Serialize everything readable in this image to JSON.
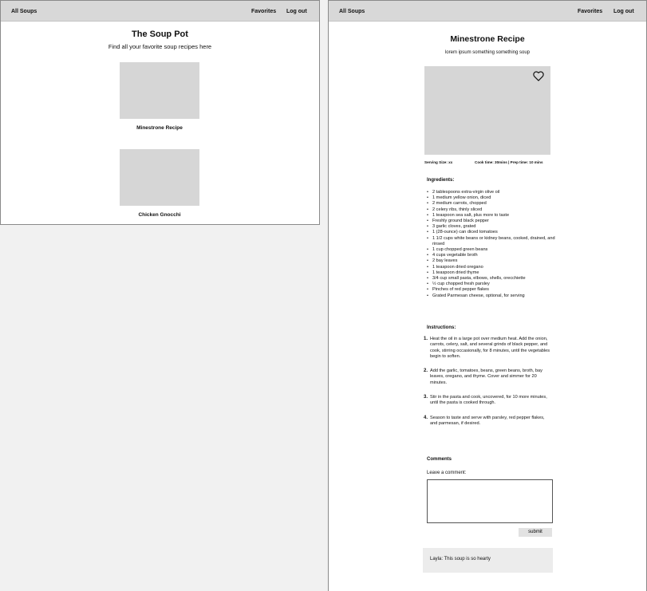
{
  "home": {
    "nav": {
      "all_soups": "All Soups",
      "favorites": "Favorites",
      "logout": "Log out"
    },
    "title": "The Soup Pot",
    "subtitle": "Find all your favorite soup recipes here",
    "recipes": [
      {
        "label": "Minestrone Recipe"
      },
      {
        "label": "Chicken Gnocchi"
      }
    ]
  },
  "recipe": {
    "nav": {
      "all_soups": "All Soups",
      "favorites": "Favorites",
      "logout": "Log out"
    },
    "title": "Minestrone Recipe",
    "subtitle": "lorem ipsum something something soup",
    "heart_icon": "heart-outline-icon",
    "serving_size": "Serving Size: xx",
    "times": "Cook time: 30mins | Prep time: 10 mins",
    "ingredients_title": "Ingredients:",
    "ingredients": [
      "2 tablespoons extra-virgin olive oil",
      "1 medium yellow onion, diced",
      "2 medium carrots, chopped",
      "2 celery ribs, thinly sliced",
      "1 teaspoon sea salt, plus more to taste",
      "Freshly ground black pepper",
      "3 garlic cloves, grated",
      "1 (28-ounce) can diced tomatoes",
      "1 1/2 cups white beans or kidney beans, cooked, drained, and rinsed",
      "1 cup chopped green beans",
      "4 cups vegetable broth",
      "2 bay leaves",
      "1 teaspoon dried oregano",
      "1 teaspoon dried thyme",
      "3/4 cup small pasta, elbows, shells, orecchiette",
      "½ cup chopped fresh parsley",
      "Pinches of red pepper flakes",
      "Grated Parmesan cheese, optional, for serving"
    ],
    "instructions_title": "Instructions:",
    "instructions": [
      {
        "num": "1.",
        "text": "Heat the oil in a large pot over medium heat. Add the onion, carrots, celery, salt, and several grinds of black pepper, and cook, stirring occasionally, for 8 minutes, until the vegetables begin to soften."
      },
      {
        "num": "2.",
        "text": "Add the garlic, tomatoes, beans, green beans, broth, bay leaves, oregano, and thyme. Cover and simmer for 20 minutes."
      },
      {
        "num": "3.",
        "text": "Stir in the pasta and cook, uncovered, for 10 more minutes, until the pasta is cooked through."
      },
      {
        "num": "4.",
        "text": "Season to taste and serve with parsley, red pepper flakes, and parmesan, if desired."
      }
    ],
    "comments_title": "Comments",
    "leave_comment_label": "Leave a comment:",
    "comment_value": "",
    "submit_label": "submit",
    "comments": [
      {
        "text": "Layla: This soup is so hearty"
      }
    ]
  }
}
